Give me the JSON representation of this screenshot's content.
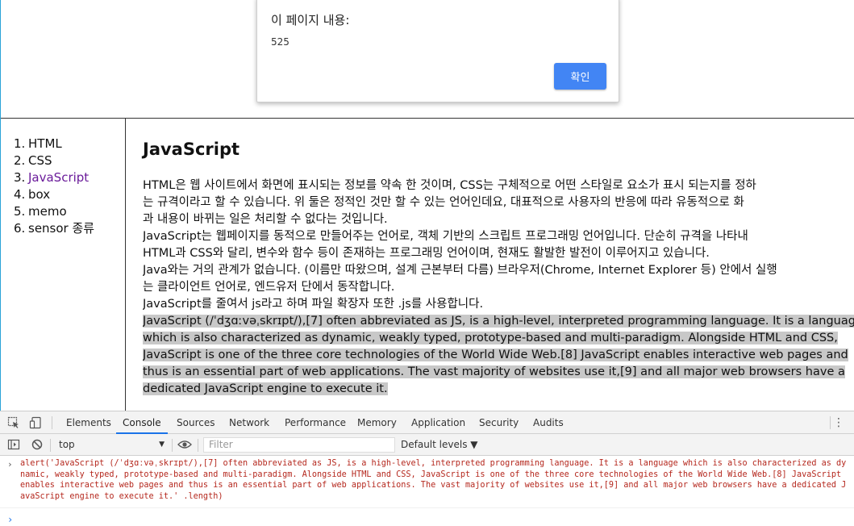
{
  "dialog": {
    "title": "이 페이지 내용:",
    "message": "525",
    "ok_label": "확인"
  },
  "nav": {
    "items": [
      {
        "num": "1.",
        "label": "HTML"
      },
      {
        "num": "2.",
        "label": "CSS"
      },
      {
        "num": "3.",
        "label": "JavaScript"
      },
      {
        "num": "4.",
        "label": "box"
      },
      {
        "num": "5.",
        "label": "memo"
      },
      {
        "num": "6.",
        "label": "sensor 종류"
      }
    ]
  },
  "content": {
    "title": "JavaScript",
    "lines": [
      "HTML은 웹 사이트에서 화면에 표시되는 정보를 약속 한 것이며, CSS는 구체적으로 어떤 스타일로 요소가 표시 되는지를 정하",
      "는 규격이라고 할 수 있습니다. 위 둘은 정적인 것만 할 수 있는 언어인데요, 대표적으로 사용자의 반응에 따라 유동적으로 화",
      "과 내용이 바뀌는 일은 처리할 수 없다는 것입니다.",
      "JavaScript는 웹페이지를 동적으로 만들어주는 언어로, 객체 기반의 스크립트 프로그래밍 언어입니다. 단순히 규격을 나타내",
      "HTML과 CSS와 달리, 변수와 함수 등이 존재하는 프로그래밍 언어이며, 현재도 활발한 발전이 이루어지고 있습니다.",
      "Java와는 거의 관계가 없습니다. (이름만 따왔으며, 설계 근본부터 다름) 브라우저(Chrome, Internet Explorer 등) 안에서 실행",
      "는 클라이언트 언어로, 엔드유저 단에서 동작합니다.",
      "JavaScript를 줄여서 js라고 하며 파일 확장자 또한 .js를 사용합니다."
    ],
    "selected_lines": [
      "JavaScript (/ˈdʒɑːvəˌskrɪpt/),[7] often abbreviated as JS, is a high-level, interpreted programming language. It is a languag",
      "which is also characterized as dynamic, weakly typed, prototype-based and multi-paradigm. Alongside HTML and CSS,",
      "JavaScript is one of the three core technologies of the World Wide Web.[8] JavaScript enables interactive web pages and",
      "thus is an essential part of web applications. The vast majority of websites use it,[9] and all major web browsers have a",
      "dedicated JavaScript engine to execute it."
    ]
  },
  "devtools": {
    "tabs": [
      "Elements",
      "Console",
      "Sources",
      "Network",
      "Performance",
      "Memory",
      "Application",
      "Security",
      "Audits"
    ],
    "active_tab": "Console",
    "context": "top",
    "filter_placeholder": "Filter",
    "levels_label": "Default levels ▼",
    "console_input": "alert('JavaScript (/ˈdʒɑːvəˌskrɪpt/),[7] often abbreviated as JS, is a high-level, interpreted programming language. It is a language which is also characterized as dynamic, weakly typed, prototype-based and multi-paradigm. Alongside HTML and CSS, JavaScript is one of the three core technologies of the World Wide Web.[8] JavaScript enables interactive web pages and thus is an essential part of web applications. The vast majority of websites use it,[9] and all major web browsers have a dedicated JavaScript engine to execute it.' .length)",
    "icons": [
      "inspect-element-icon",
      "device-toolbar-icon",
      "more-options-icon",
      "execution-context-icon",
      "clear-console-icon",
      "eye-icon"
    ]
  },
  "colors": {
    "accent_button": "#4285f4",
    "visited_link": "#6a1b9a",
    "selection_bg": "#c8c8c8",
    "console_text": "#b5281e",
    "active_tab_underline": "#1a73e8"
  }
}
